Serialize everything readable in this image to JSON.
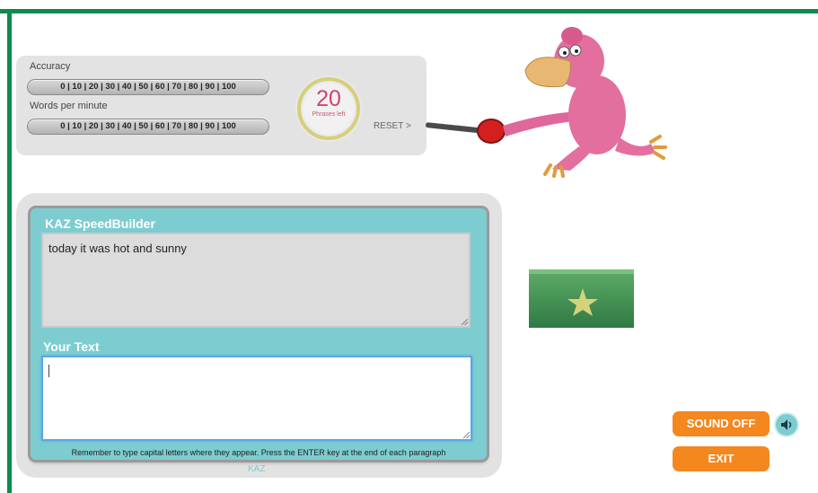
{
  "stats": {
    "accuracy_label": "Accuracy",
    "wpm_label": "Words per minute",
    "scale": "0 | 10 | 20 | 30 | 40 | 50 | 60 | 70 | 80 | 90 | 100",
    "phrases_left_count": "20",
    "phrases_left_label": "Phrases left",
    "reset": "RESET >"
  },
  "builder": {
    "title": "KAZ SpeedBuilder",
    "prompt": "today it was hot and sunny",
    "your_text_label": "Your Text",
    "input_value": "",
    "footnote": "Remember to type capital letters where they appear. Press the ENTER key at the end of each paragraph",
    "kaz": "KAZ"
  },
  "controls": {
    "sound_off": "SOUND OFF",
    "exit": "EXIT"
  },
  "icons": {
    "speaker": "speaker-icon",
    "star": "star-icon"
  },
  "colors": {
    "frame": "#0e8a4e",
    "panel_teal": "#7dcdd0",
    "button_orange": "#f5871f",
    "counter_pink": "#d1446d"
  }
}
